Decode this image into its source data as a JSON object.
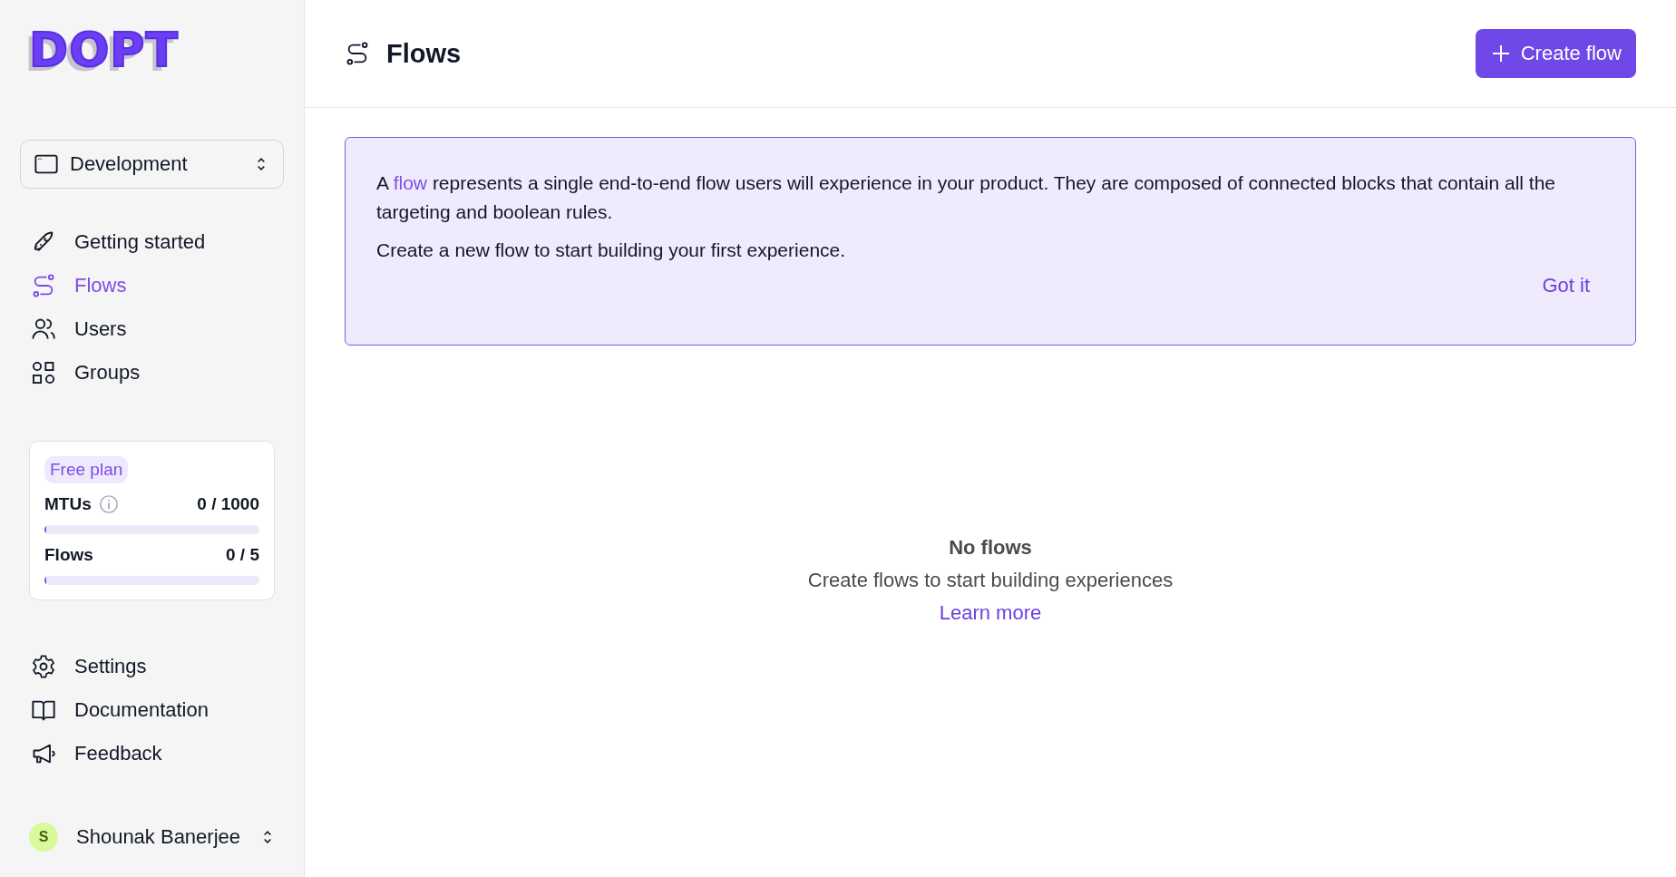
{
  "sidebar": {
    "logo": "DOPT",
    "environment": "Development",
    "nav_items": [
      {
        "label": "Getting started",
        "selected": false
      },
      {
        "label": "Flows",
        "selected": true
      },
      {
        "label": "Users",
        "selected": false
      },
      {
        "label": "Groups",
        "selected": false
      }
    ],
    "plan": {
      "badge": "Free plan",
      "meters": [
        {
          "label": "MTUs",
          "info": true,
          "reading": "0 / 1000",
          "level": 0
        },
        {
          "label": "Flows",
          "info": false,
          "reading": "0 / 5",
          "level": 0
        }
      ]
    },
    "bottom_items": [
      {
        "label": "Settings"
      },
      {
        "label": "Documentation"
      },
      {
        "label": "Feedback"
      }
    ],
    "user": {
      "initial": "S",
      "name": "Shounak Banerjee"
    }
  },
  "header": {
    "title": "Flows",
    "button": "Create flow"
  },
  "banner": {
    "before": "A ",
    "link": "flow",
    "after": " represents a single end-to-end flow users will experience in your product. They are composed of connected blocks that contain all the targeting and boolean rules.",
    "second": "Create a new flow to start building your first experience.",
    "dismiss": "Got it"
  },
  "empty_state": {
    "title": "No flows",
    "text": "Create flows to start building experiences",
    "link": "Learn more"
  }
}
